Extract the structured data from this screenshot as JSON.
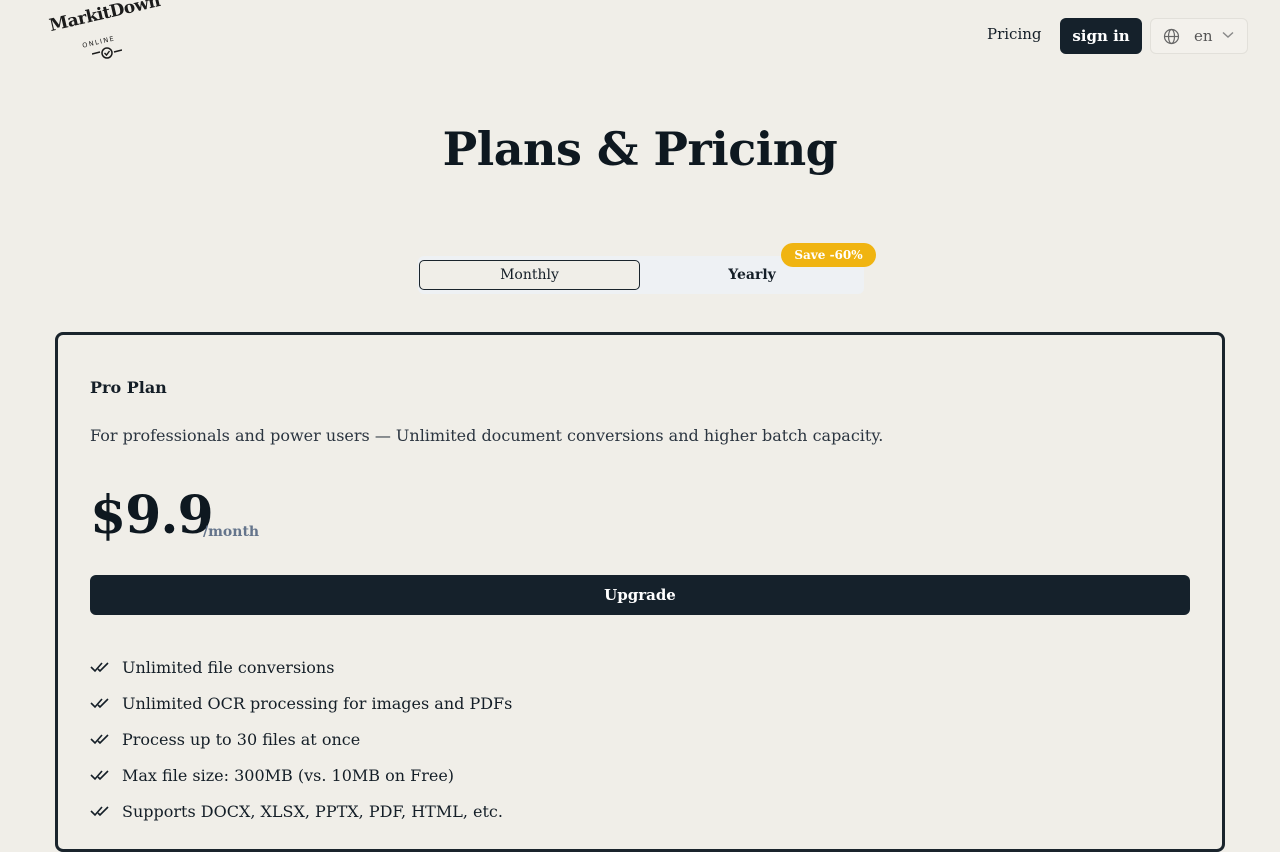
{
  "header": {
    "logo": {
      "word": "MarkitDown",
      "sub": "ONLINE"
    },
    "nav": {
      "pricing": "Pricing"
    },
    "signin_label": "sign in",
    "language": {
      "value": "en"
    }
  },
  "page": {
    "title": "Plans & Pricing"
  },
  "billing": {
    "monthly_label": "Monthly",
    "yearly_label": "Yearly",
    "selected": "Monthly",
    "save_badge": "Save -60%"
  },
  "plan": {
    "name": "Pro Plan",
    "description": "For professionals and power users — Unlimited document conversions and higher batch capacity.",
    "price": "$9.9",
    "period": "/month",
    "cta": "Upgrade",
    "features": [
      "Unlimited file conversions",
      "Unlimited OCR processing for images and PDFs",
      "Process up to 30 files at once",
      "Max file size: 300MB (vs. 10MB on Free)",
      "Supports DOCX, XLSX, PPTX, PDF, HTML, etc."
    ]
  },
  "colors": {
    "background": "#f0eee8",
    "primary": "#15212b",
    "badge": "#f0b411",
    "muted": "#64748b"
  }
}
